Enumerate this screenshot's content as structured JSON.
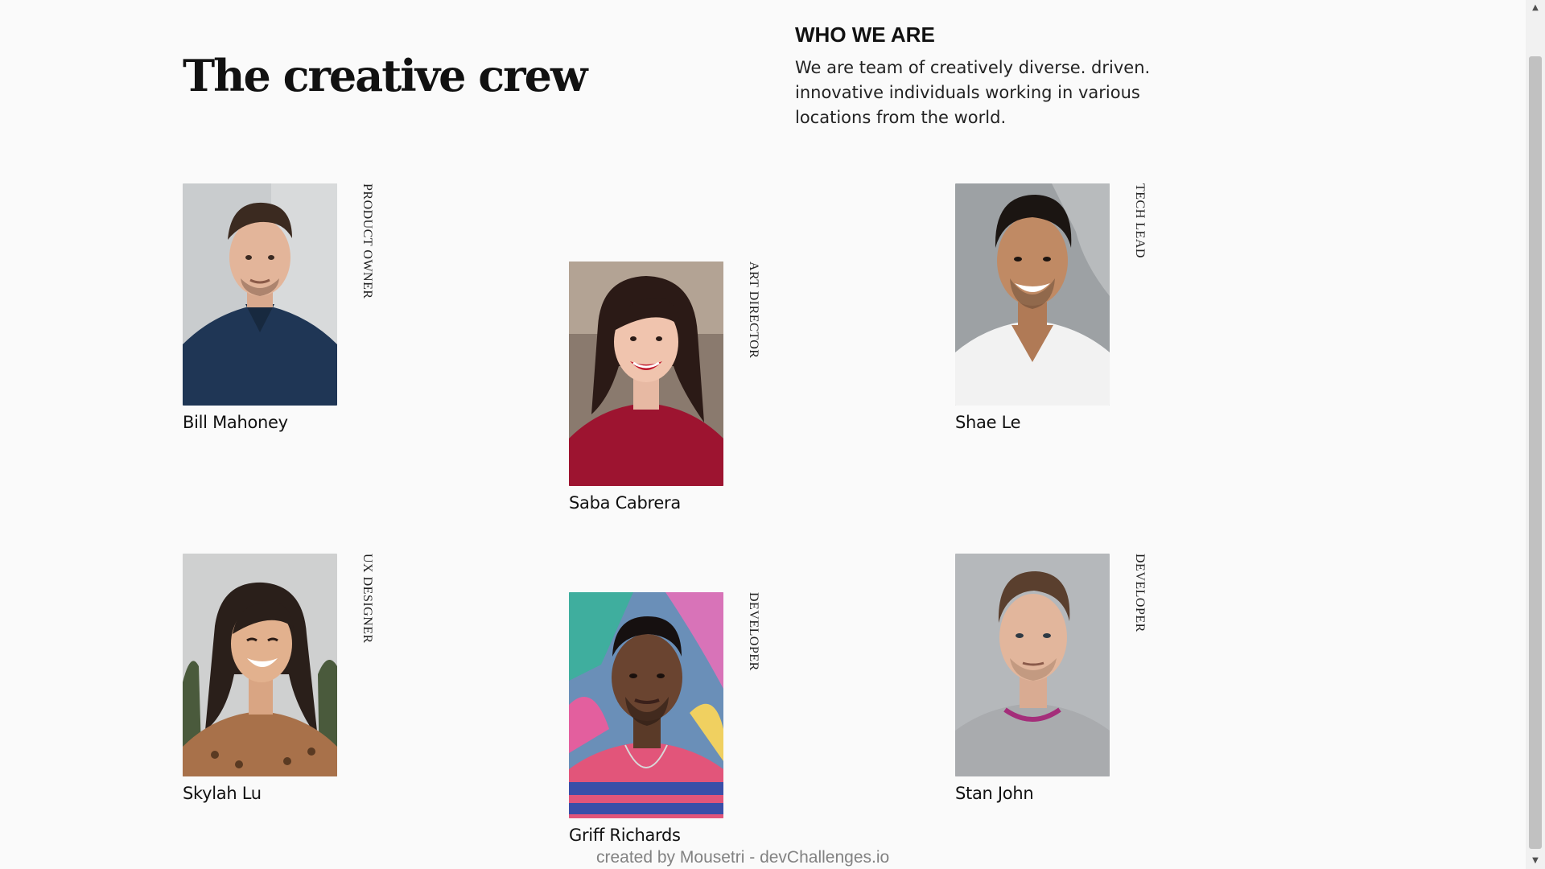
{
  "header": {
    "title": "The creative crew"
  },
  "about": {
    "heading": "WHO WE ARE",
    "text": "We are team of creatively diverse. driven. innovative individuals working in various locations from the world."
  },
  "members": [
    {
      "name": "Bill Mahoney",
      "role": "PRODUCT OWNER"
    },
    {
      "name": "Saba Cabrera",
      "role": "ART DIRECTOR"
    },
    {
      "name": "Shae Le",
      "role": "TECH LEAD"
    },
    {
      "name": "Skylah Lu",
      "role": "UX DESIGNER"
    },
    {
      "name": "Griff Richards",
      "role": "DEVELOPER"
    },
    {
      "name": "Stan John",
      "role": "DEVELOPER"
    }
  ],
  "footer": {
    "credit": "created by Mousetri - devChallenges.io"
  },
  "colors": {
    "background": "#fafafa",
    "text": "#111111",
    "footer_text": "#828282"
  },
  "icons": {
    "scroll_up": "triangle-up-icon",
    "scroll_down": "triangle-down-icon"
  }
}
